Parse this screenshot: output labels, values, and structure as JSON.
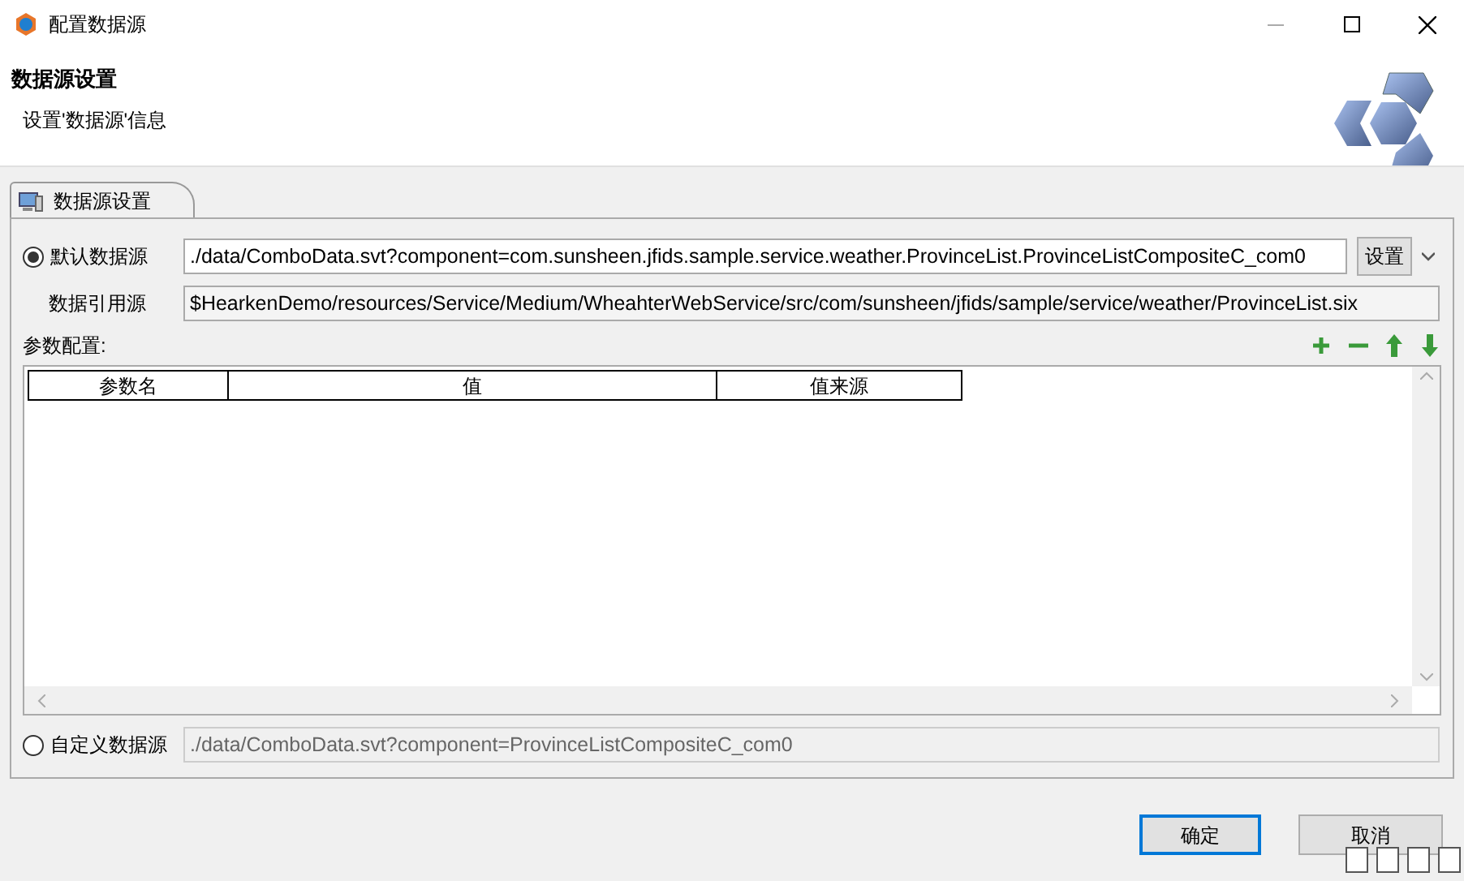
{
  "window": {
    "title": "配置数据源"
  },
  "header": {
    "title": "数据源设置",
    "subtitle": "设置'数据源'信息"
  },
  "tabs": [
    {
      "label": "数据源设置",
      "selected": true
    }
  ],
  "default_source": {
    "label": "默认数据源",
    "selected": true,
    "value": "./data/ComboData.svt?component=com.sunsheen.jfids.sample.service.weather.ProvinceList.ProvinceListCompositeC_com0",
    "button": "设置"
  },
  "reference_source": {
    "label": "数据引用源",
    "value": "$HearkenDemo/resources/Service/Medium/WheahterWebService/src/com/sunsheen/jfids/sample/service/weather/ProvinceList.six"
  },
  "params": {
    "label": "参数配置:",
    "columns": [
      "参数名",
      "值",
      "值来源"
    ]
  },
  "custom_source": {
    "label": "自定义数据源",
    "selected": false,
    "value": "./data/ComboData.svt?component=ProvinceListCompositeC_com0"
  },
  "buttons": [
    "确定",
    "取消"
  ]
}
